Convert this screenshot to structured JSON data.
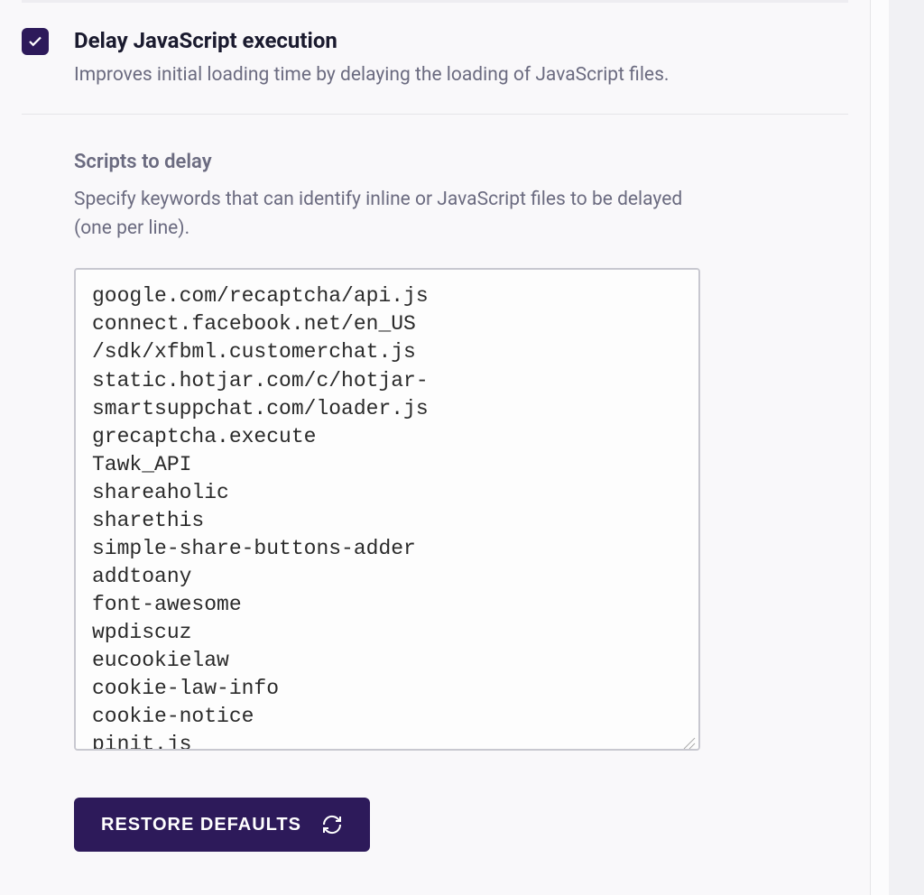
{
  "section": {
    "title": "Delay JavaScript execution",
    "description": "Improves initial loading time by delaying the loading of JavaScript files."
  },
  "subsection": {
    "title": "Scripts to delay",
    "description": "Specify keywords that can identify inline or JavaScript files to be delayed (one per line)."
  },
  "textarea_value": "google.com/recaptcha/api.js\nconnect.facebook.net/en_US\n/sdk/xfbml.customerchat.js\nstatic.hotjar.com/c/hotjar-\nsmartsuppchat.com/loader.js\ngrecaptcha.execute\nTawk_API\nshareaholic\nsharethis\nsimple-share-buttons-adder\naddtoany\nfont-awesome\nwpdiscuz\neucookielaw\ncookie-law-info\ncookie-notice\npinit.js",
  "button": {
    "restore_defaults": "RESTORE DEFAULTS"
  }
}
